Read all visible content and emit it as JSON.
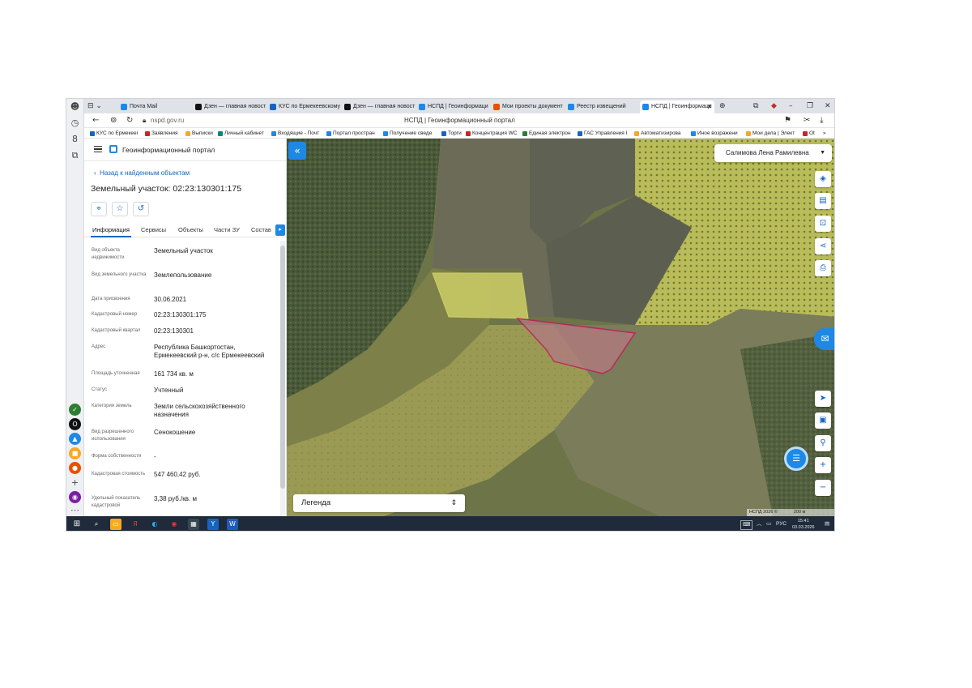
{
  "browser": {
    "tabs": [
      {
        "label": "Почта Mail",
        "color": "#1e88e5"
      },
      {
        "label": "Дзен — главная новост",
        "color": "#111111"
      },
      {
        "label": "КУС по Ермекеевскому",
        "color": "#1565c0"
      },
      {
        "label": "Дзен — главная новост",
        "color": "#111111"
      },
      {
        "label": "НСПД | Геоинформаци",
        "color": "#1e88e5"
      },
      {
        "label": "Мои проекты документ",
        "color": "#e65100"
      },
      {
        "label": "Реестр извещений",
        "color": "#1e88e5"
      },
      {
        "label": "НСПД | Геоинформаци",
        "color": "#1e88e5"
      }
    ],
    "url": "nspd.gov.ru",
    "page_title": "НСПД | Геоинформационный портал",
    "bookmarks": [
      {
        "label": "КУС по Ермекееі",
        "color": "#1565c0"
      },
      {
        "label": "Заявления",
        "color": "#c62828"
      },
      {
        "label": "Выписки",
        "color": "#f9a825"
      },
      {
        "label": "Личный кабинет",
        "color": "#00897b"
      },
      {
        "label": "Входящие - Почт",
        "color": "#1e88e5"
      },
      {
        "label": "Портал простран",
        "color": "#1e88e5"
      },
      {
        "label": "Получение сведе",
        "color": "#1e88e5"
      },
      {
        "label": "Торги",
        "color": "#1565c0"
      },
      {
        "label": "Концентрация WC",
        "color": "#c62828"
      },
      {
        "label": "Единая электрон",
        "color": "#2e7d32"
      },
      {
        "label": "ГАС Управления І",
        "color": "#1565c0"
      },
      {
        "label": "Автоматизирова",
        "color": "#f9a825"
      },
      {
        "label": "Иное возражени",
        "color": "#1e88e5"
      },
      {
        "label": "Мои дела | Элект",
        "color": "#f9a825"
      },
      {
        "label": "Ot",
        "color": "#c62828"
      }
    ]
  },
  "portal": {
    "name": "Геоинформационный портал",
    "back_link": "Назад к найденным объектам",
    "object_title": "Земельный участок: 02:23:130301:175",
    "tabs": [
      "Информация",
      "Сервисы",
      "Объекты",
      "Части ЗУ",
      "Состав"
    ],
    "properties": [
      {
        "label": "Вид объекта недвижимости",
        "value": "Земельный участок"
      },
      {
        "label": "Вид земельного участка",
        "value": "Землепользование"
      },
      {
        "label": "Дата присвоения",
        "value": "30.06.2021"
      },
      {
        "label": "Кадастровый номер",
        "value": "02:23:130301:175"
      },
      {
        "label": "Кадастровый квартал",
        "value": "02:23:130301"
      },
      {
        "label": "Адрес",
        "value": "Республика Башкортостан, Ермекеевский р-н, с/с Ермекеевский"
      },
      {
        "label": "Площадь уточненная",
        "value": "161 734 кв. м"
      },
      {
        "label": "Статус",
        "value": "Учтенный"
      },
      {
        "label": "Категория земель",
        "value": "Земли сельскохозяйственного назначения"
      },
      {
        "label": "Вид разрешенного использования",
        "value": "Сенокошение"
      },
      {
        "label": "Форма собственности",
        "value": "-"
      },
      {
        "label": "Кадастровая стоимость",
        "value": "547 460,42 руб."
      },
      {
        "label": "Удельный показатель кадастровой",
        "value": "3,38 руб./кв. м"
      }
    ]
  },
  "map": {
    "user_name": "Салимова Лена Рамилевна",
    "legend_label": "Легенда",
    "attribution": "НСПД 2026 ©",
    "scale_label": "200 м",
    "highlight_color": "#c2185b",
    "accent_color": "#1e88e5"
  },
  "taskbar": {
    "language": "РУС",
    "time": "15:41",
    "date": "03.03.2026"
  }
}
